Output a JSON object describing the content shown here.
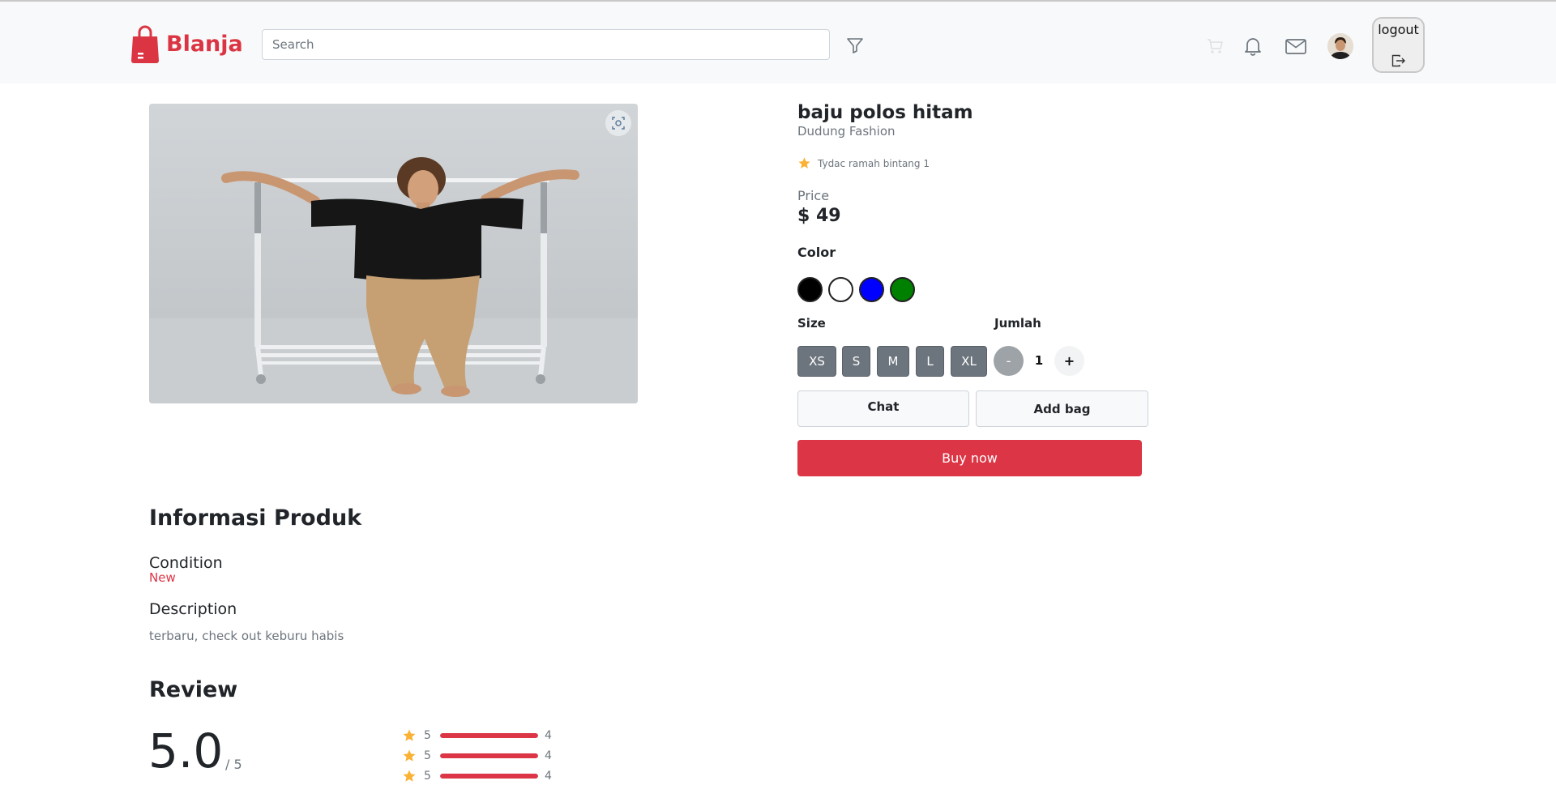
{
  "navbar": {
    "brand_name": "Blanja",
    "search_placeholder": "Search",
    "logout_label": "logout"
  },
  "product": {
    "name": "baju polos hitam",
    "shop": "Dudung Fashion",
    "rating_text": "Tydac ramah bintang 1",
    "price_label": "Price",
    "price": "$ 49",
    "color_label": "Color",
    "colors": [
      "#000000",
      "#ffffff",
      "#0000ff",
      "#008000"
    ],
    "size_label": "Size",
    "sizes": [
      "XS",
      "S",
      "M",
      "L",
      "XL"
    ],
    "quantity_label": "Jumlah",
    "quantity": "1",
    "minus_label": "-",
    "plus_label": "+",
    "chat_label": "Chat",
    "add_bag_label": "Add bag",
    "buy_label": "Buy now"
  },
  "info": {
    "heading": "Informasi Produk",
    "condition_label": "Condition",
    "condition_value": "New",
    "description_label": "Description",
    "description": "terbaru, check out keburu habis"
  },
  "review": {
    "heading": "Review",
    "score": "5.0",
    "score_max": "/ 5",
    "rows": [
      {
        "stars": "5",
        "fill": 1.0,
        "count": "4"
      },
      {
        "stars": "5",
        "fill": 1.0,
        "count": "4"
      },
      {
        "stars": "5",
        "fill": 1.0,
        "count": "4"
      }
    ]
  },
  "icons": {
    "brand": "shopping-bag-icon",
    "filter": "filter-icon",
    "cart": "cart-icon",
    "notifications": "bell-icon",
    "messages": "mail-icon",
    "logout": "logout-icon",
    "zoom": "focus-icon",
    "star": "star-icon"
  },
  "colors": {
    "brand": "#db3543",
    "buy": "#dc3545",
    "size_button": "#6c757d",
    "star": "#f9b233"
  }
}
